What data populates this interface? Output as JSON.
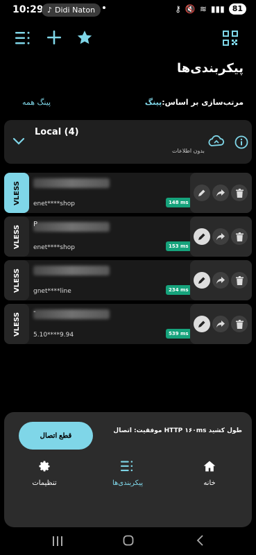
{
  "status_bar": {
    "time": "10:29",
    "notification_app": "Didi Naton",
    "battery": "81"
  },
  "toolbar": {
    "menu_icon": "menu-icon",
    "add_icon": "plus-icon",
    "star_icon": "star-icon",
    "qr_icon": "qr-code-icon"
  },
  "page_title": "پیکربندی‌ها",
  "sort_row": {
    "ping_all": "پینگ همه",
    "sort_prefix": "مرتب‌سازی بر اساس:",
    "sort_value": "پینگ"
  },
  "group": {
    "name": "Local (4)",
    "subtitle": "بدون اطلاعات"
  },
  "servers": [
    {
      "protocol": "VLESS",
      "first_char": "",
      "host": "enet****shop",
      "latency": "148 ms",
      "active": true
    },
    {
      "protocol": "VLESS",
      "first_char": "P",
      "host": "enet****shop",
      "latency": "153 ms",
      "active": false
    },
    {
      "protocol": "VLESS",
      "first_char": "",
      "host": "gnet****line",
      "latency": "234 ms",
      "active": false
    },
    {
      "protocol": "VLESS",
      "first_char": "-",
      "host": "5.10****9.94",
      "latency": "539 ms",
      "active": false
    }
  ],
  "bottom_sheet": {
    "disconnect_label": "قطع اتصال",
    "status_message": "موفقیت: اتصال HTTP ۱۶۰ms طول کشید",
    "nav": [
      {
        "label": "تنظیمات",
        "icon": "gear-icon",
        "active": false
      },
      {
        "label": "پیکربندی‌ها",
        "icon": "list-icon",
        "active": true
      },
      {
        "label": "خانه",
        "icon": "home-icon",
        "active": false
      }
    ]
  },
  "colors": {
    "accent": "#7fd6e8",
    "latency_badge": "#16a37c",
    "background": "#000000"
  }
}
